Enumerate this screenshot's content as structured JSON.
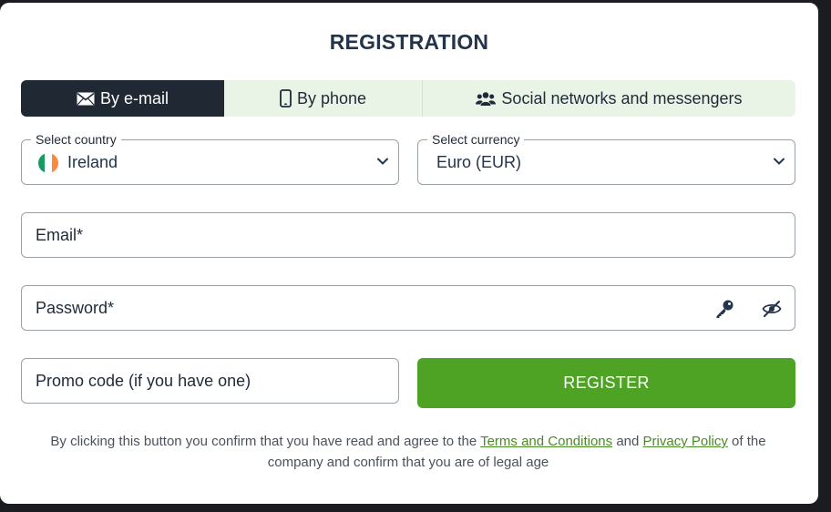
{
  "title": "REGISTRATION",
  "tabs": [
    {
      "label": "By e-mail",
      "icon": "envelope-icon",
      "active": true
    },
    {
      "label": "By phone",
      "icon": "phone-icon",
      "active": false
    },
    {
      "label": "Social networks and messengers",
      "icon": "users-icon",
      "active": false
    }
  ],
  "country": {
    "legend": "Select country",
    "value": "Ireland",
    "flag_colors": [
      "#169b62",
      "#ffffff",
      "#ff883e"
    ]
  },
  "currency": {
    "legend": "Select currency",
    "value": "Euro (EUR)"
  },
  "email": {
    "placeholder": "Email*"
  },
  "password": {
    "placeholder": "Password*",
    "icons": [
      "key-icon",
      "eye-slash-icon"
    ]
  },
  "promo": {
    "placeholder": "Promo code (if you have one)"
  },
  "register_label": "REGISTER",
  "disclaimer": {
    "before": "By clicking this button you confirm that you have read and agree to the ",
    "terms_link": "Terms and Conditions",
    "and": " and ",
    "privacy_link": "Privacy Policy",
    "after": " of the company and confirm that you are of legal age"
  },
  "colors": {
    "accent_green": "#4fa324",
    "dark_tab": "#1f2833",
    "tab_bg": "#eaf4e6",
    "title": "#23344b",
    "link": "#4a8a26"
  }
}
